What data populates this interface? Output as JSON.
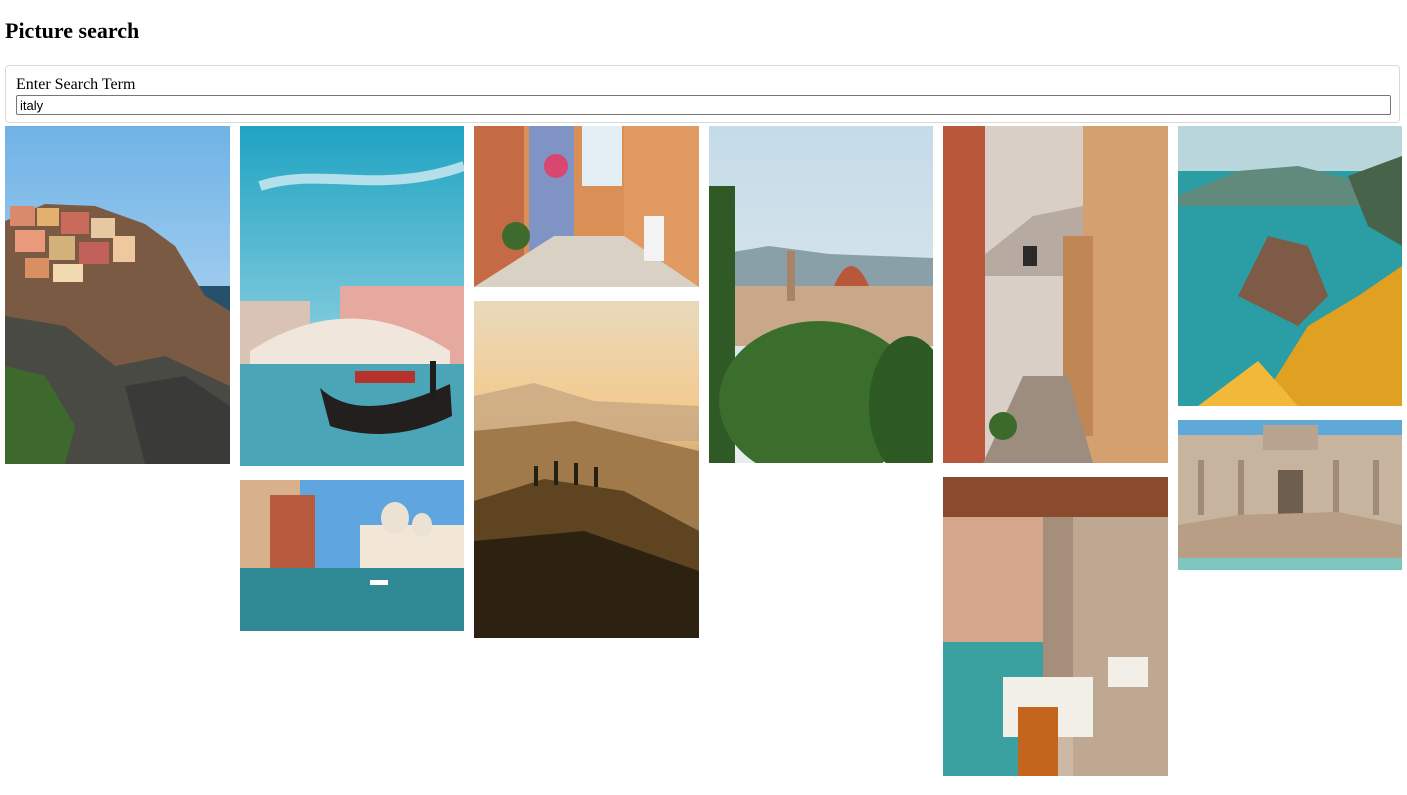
{
  "page": {
    "title": "Picture search"
  },
  "search": {
    "label": "Enter Search Term",
    "value": "italy"
  },
  "results": [
    "cinque-terre-manarola-cliff-village",
    "venice-rialto-bridge-gondola",
    "venice-grand-canal-santa-maria-della-salute",
    "colorful-alley-with-scooter",
    "tuscany-hills-sunset",
    "florence-duomo-skyline",
    "stone-stair-street-with-lantern",
    "venice-canal-restaurant-terrace",
    "vernazza-coast-yellow-flowers",
    "trevi-fountain-rome"
  ]
}
